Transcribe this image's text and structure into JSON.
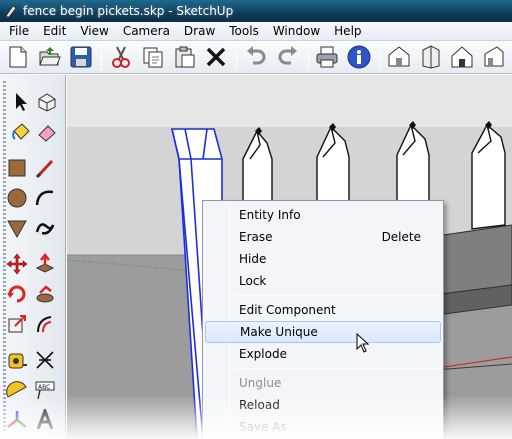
{
  "window": {
    "title": "fence begin pickets.skp - SketchUp"
  },
  "menubar": {
    "items": [
      "File",
      "Edit",
      "View",
      "Camera",
      "Draw",
      "Tools",
      "Window",
      "Help"
    ]
  },
  "toolbar": {
    "icons": [
      "new-icon",
      "open-icon",
      "save-icon",
      "cut-icon",
      "copy-icon",
      "paste-icon",
      "delete-icon",
      "undo-icon",
      "redo-icon",
      "print-icon",
      "model-info-icon",
      "iso-view-icon",
      "top-view-icon",
      "front-view-icon",
      "right-view-icon"
    ]
  },
  "left_toolbar": {
    "icons": [
      "select-icon",
      "make-component-icon",
      "paint-bucket-icon",
      "eraser-icon",
      "rectangle-icon",
      "line-icon",
      "circle-icon",
      "arc-icon",
      "polygon-icon",
      "freehand-icon",
      "move-icon",
      "push-pull-icon",
      "rotate-icon",
      "follow-me-icon",
      "scale-icon",
      "offset-icon",
      "tape-measure-icon",
      "dimension-icon",
      "protractor-icon",
      "text-icon",
      "axes-icon",
      "3d-text-icon"
    ]
  },
  "context_menu": {
    "items": [
      {
        "label": "Entity Info",
        "shortcut": ""
      },
      {
        "label": "Erase",
        "shortcut": "Delete"
      },
      {
        "label": "Hide",
        "shortcut": ""
      },
      {
        "label": "Lock",
        "shortcut": ""
      },
      {
        "label": "Edit Component",
        "shortcut": ""
      },
      {
        "label": "Make Unique",
        "shortcut": ""
      },
      {
        "label": "Explode",
        "shortcut": ""
      },
      {
        "label": "Unglue",
        "shortcut": ""
      },
      {
        "label": "Reload",
        "shortcut": ""
      },
      {
        "label": "Save As",
        "shortcut": ""
      }
    ],
    "highlighted": "Make Unique",
    "disabled": [
      "Unglue",
      "Save As"
    ]
  },
  "colors": {
    "titlebar": "#0f3c5c",
    "sky": "#d6d6d6",
    "ground": "#9a9a9a",
    "selection": "#1f2fd8",
    "menu_highlight": "#d9e9fb"
  }
}
